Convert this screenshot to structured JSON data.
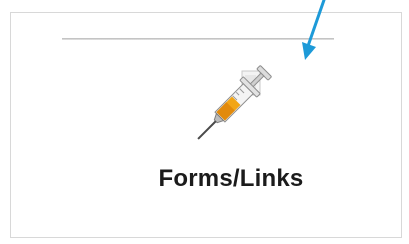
{
  "tile": {
    "label": "Forms/Links",
    "icon": "syringe-icon"
  },
  "colors": {
    "arrow": "#1d9ad8",
    "text": "#1b1b1b",
    "divider": "#c8c8c8"
  }
}
